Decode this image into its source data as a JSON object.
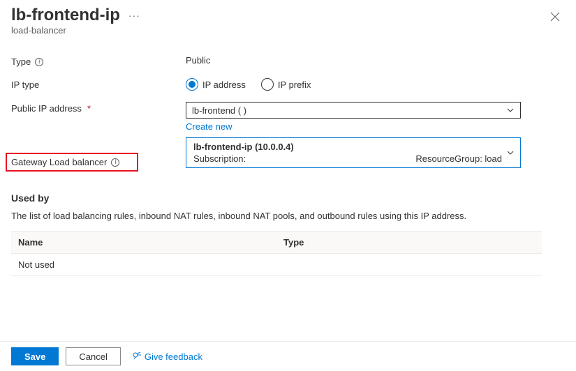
{
  "header": {
    "title": "lb-frontend-ip",
    "subtitle": "load-balancer"
  },
  "form": {
    "type_label": "Type",
    "type_value": "Public",
    "ip_type_label": "IP type",
    "ip_type_options": {
      "address": "IP address",
      "prefix": "IP prefix"
    },
    "public_ip_label": "Public IP address",
    "public_ip_value": "lb-frontend (                          )",
    "create_new": "Create new",
    "gateway_label": "Gateway Load balancer",
    "gateway_value_title": "lb-frontend-ip (10.0.0.4)",
    "gateway_sub_left": "Subscription:",
    "gateway_sub_right": "ResourceGroup: load"
  },
  "used_by": {
    "title": "Used by",
    "description": "The list of load balancing rules, inbound NAT rules, inbound NAT pools, and outbound rules using this IP address.",
    "columns": {
      "name": "Name",
      "type": "Type"
    },
    "empty": "Not used"
  },
  "footer": {
    "save": "Save",
    "cancel": "Cancel",
    "feedback": "Give feedback"
  }
}
